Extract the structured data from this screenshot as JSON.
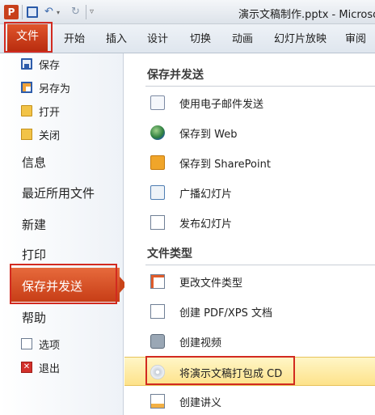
{
  "titlebar": {
    "app_icon": "P",
    "title": "演示文稿制作.pptx - Microsof",
    "quick_access": [
      "save-icon",
      "undo-icon",
      "redo-icon",
      "customize-icon"
    ]
  },
  "ribbon": {
    "file_tab": "文件",
    "tabs": [
      "开始",
      "插入",
      "设计",
      "切换",
      "动画",
      "幻灯片放映",
      "审阅"
    ]
  },
  "leftnav": {
    "save": "保存",
    "save_as": "另存为",
    "open": "打开",
    "close": "关闭",
    "info": "信息",
    "recent": "最近所用文件",
    "new": "新建",
    "print": "打印",
    "save_send": "保存并发送",
    "help": "帮助",
    "options": "选项",
    "exit": "退出",
    "exit_glyph": "✕"
  },
  "content": {
    "section1_title": "保存并发送",
    "section1_items": [
      "使用电子邮件发送",
      "保存到 Web",
      "保存到 SharePoint",
      "广播幻灯片",
      "发布幻灯片"
    ],
    "section2_title": "文件类型",
    "section2_items": [
      "更改文件类型",
      "创建 PDF/XPS 文档",
      "创建视频",
      "将演示文稿打包成 CD",
      "创建讲义"
    ]
  },
  "colors": {
    "accent": "#c73d16",
    "highlight_outline": "#d22a20",
    "selected_item": "#fde28a"
  }
}
